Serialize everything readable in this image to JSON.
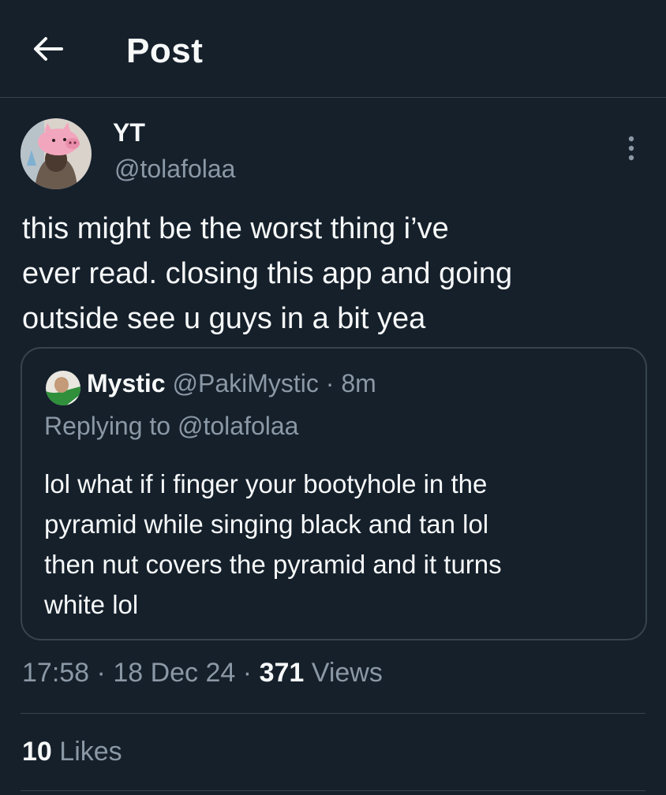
{
  "header": {
    "back_icon": "arrow-left-icon",
    "title": "Post"
  },
  "author": {
    "display_name": "YT",
    "handle": "@tolafolaa",
    "avatar_icon": "avatar-pink-pig-hat",
    "more_icon": "more-vertical-icon"
  },
  "tweet": {
    "text_lines": [
      "this might be the worst thing i’ve",
      "ever read. closing this app and going",
      "outside see u guys in a bit yea"
    ]
  },
  "quote": {
    "display_name": "Mystic",
    "handle": "@PakiMystic",
    "separator": "·",
    "time": "8m",
    "replying_to": "Replying to @tolafolaa",
    "text_lines": [
      "lol what if i finger your bootyhole in the",
      "pyramid while singing black and tan lol",
      "then nut covers the pyramid and it turns",
      "white lol"
    ]
  },
  "meta": {
    "time": "17:58",
    "sep": "·",
    "date": "18 Dec 24",
    "views_count": "371",
    "views_label": "Views"
  },
  "stats": {
    "likes_count": "10",
    "likes_label": "Likes"
  },
  "colors": {
    "background": "#15202b",
    "text": "#f7f9f9",
    "secondary_text": "#8b98a5",
    "border": "#38444d"
  }
}
